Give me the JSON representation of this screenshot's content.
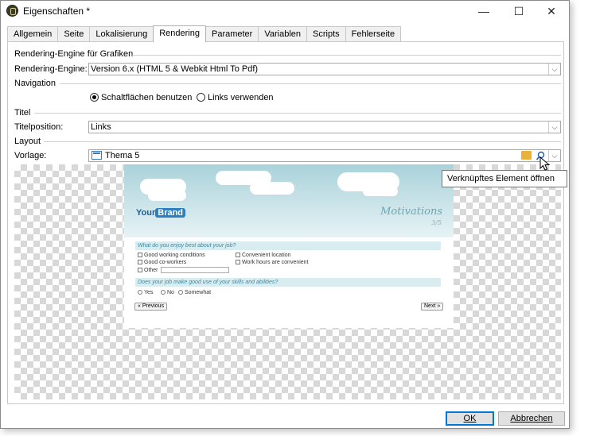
{
  "window": {
    "title": "Eigenschaften *"
  },
  "titlebar_buttons": {
    "minimize": "—",
    "maximize": "☐",
    "close": "✕"
  },
  "tabs": [
    {
      "label": "Allgemein"
    },
    {
      "label": "Seite"
    },
    {
      "label": "Lokalisierung"
    },
    {
      "label": "Rendering",
      "active": true
    },
    {
      "label": "Parameter"
    },
    {
      "label": "Variablen"
    },
    {
      "label": "Scripts"
    },
    {
      "label": "Fehlerseite"
    }
  ],
  "rendering": {
    "section_title": "Rendering-Engine für Grafiken",
    "engine_label": "Rendering-Engine:",
    "engine_value": "Version 6.x (HTML 5 & Webkit Html To Pdf)"
  },
  "navigation": {
    "section_title": "Navigation",
    "option_buttons": "Schaltflächen benutzen",
    "option_links": "Links verwenden",
    "selected": "buttons"
  },
  "titel": {
    "section_title": "Titel",
    "position_label": "Titelposition:",
    "position_value": "Links"
  },
  "layout": {
    "section_title": "Layout",
    "template_label": "Vorlage:",
    "template_value": "Thema 5"
  },
  "tooltip": "Verknüpftes Element öffnen",
  "preview": {
    "brand_your": "Your",
    "brand_box": "Brand",
    "motivations": "Motivations",
    "page": "3/5",
    "question1": "What do you enjoy best about your job?",
    "options": [
      "Good working conditions",
      "Convenient location",
      "Good co-workers",
      "Work hours are convenient",
      "Other"
    ],
    "question2": "Does your job make good use of your skills and abilities?",
    "answers": [
      "Yes",
      "No",
      "Somewhat"
    ],
    "prev": "« Previous",
    "next": "Next »"
  },
  "footer": {
    "ok": "OK",
    "cancel": "Abbrechen"
  },
  "colors": {
    "accent": "#0078d7",
    "preview_sky": "#a9d2da",
    "brand": "#2d7fc0"
  }
}
